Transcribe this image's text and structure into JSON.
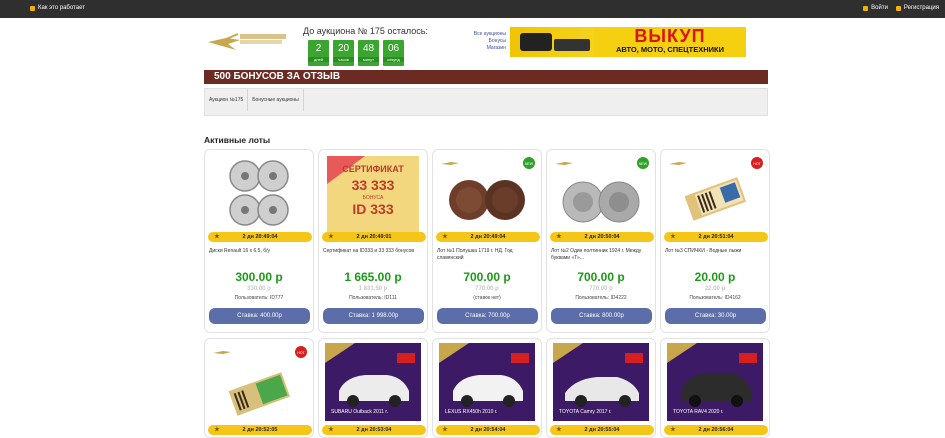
{
  "topbar": {
    "how_it_works": "Как это работает",
    "login": "Войти",
    "register": "Регистрация"
  },
  "header": {
    "countdown_title": "До аукциона № 175 осталось:",
    "counters": [
      {
        "value": "2",
        "label": "дней"
      },
      {
        "value": "20",
        "label": "часов"
      },
      {
        "value": "48",
        "label": "минут"
      },
      {
        "value": "06",
        "label": "секунд"
      }
    ],
    "mini_links": [
      "Все аукционы",
      "Бонусы",
      "Магазин"
    ],
    "banner_big": "ВЫКУП",
    "banner_small": "АВТО, МОТО, СПЕЦТЕХНИКИ"
  },
  "promo": "500 БОНУСОВ ЗА ОТЗЫВ",
  "tabs": [
    "Аукцион №175",
    "Бонусные аукционы"
  ],
  "section_title": "Активные лоты",
  "lots": [
    {
      "timer": "2 дн 20:49:04",
      "title": "Диски Renault 16 x 6.5, б/у",
      "price": "300.00 р",
      "old": "330.00 р",
      "user": "Пользователь: ID777",
      "bid": "Ставка: 400.00р",
      "badge": ""
    },
    {
      "timer": "2 дн 20:49:01",
      "title": "Сертификат на ID333 и 33 333 бонусов",
      "price": "1 665.00 р",
      "old": "1 831.50 р",
      "user": "Пользователь: ID111",
      "bid": "Ставка: 1 998.00р",
      "badge": ""
    },
    {
      "timer": "2 дн 20:49:04",
      "title": "Лот №1 Полушка 1719 г. НД. Год славянский",
      "price": "700.00 р",
      "old": "770.00 р",
      "user": "(ставок нет)",
      "bid": "Ставка: 700.00р",
      "badge": "green"
    },
    {
      "timer": "2 дн 20:50:04",
      "title": "Лот №2 Один полтинник 1924 г. Между буквами «Т»...",
      "price": "700.00 р",
      "old": "770.00 р",
      "user": "Пользователь: ID4222",
      "bid": "Ставка: 800.00р",
      "badge": "green"
    },
    {
      "timer": "2 дн 20:51:04",
      "title": "Лот №3 СПИЧКИ - Водные лыжи",
      "price": "20.00 р",
      "old": "22.00 р",
      "user": "Пользователь: ID4162",
      "bid": "Ставка: 30.00р",
      "badge": "red"
    }
  ],
  "lots2": [
    {
      "timer": "2 дн 20:52:05",
      "badge": "red",
      "kind": "matches"
    },
    {
      "timer": "2 дн 20:53:04",
      "badge": "",
      "kind": "car",
      "car_label": "SUBARU Outback 2011 г."
    },
    {
      "timer": "2 дн 20:54:04",
      "badge": "",
      "kind": "car",
      "car_label": "LEXUS RX450h 2010 г."
    },
    {
      "timer": "2 дн 20:55:04",
      "badge": "",
      "kind": "car",
      "car_label": "TOYOTA Camry 2017 г."
    },
    {
      "timer": "2 дн 20:56:04",
      "badge": "",
      "kind": "car",
      "car_label": "TOYOTA RAV4 2020 г."
    }
  ],
  "colors": {
    "green": "#1b9a15",
    "brown": "#6b2b23",
    "button": "#5b6ea9",
    "timer": "#f5c518"
  }
}
